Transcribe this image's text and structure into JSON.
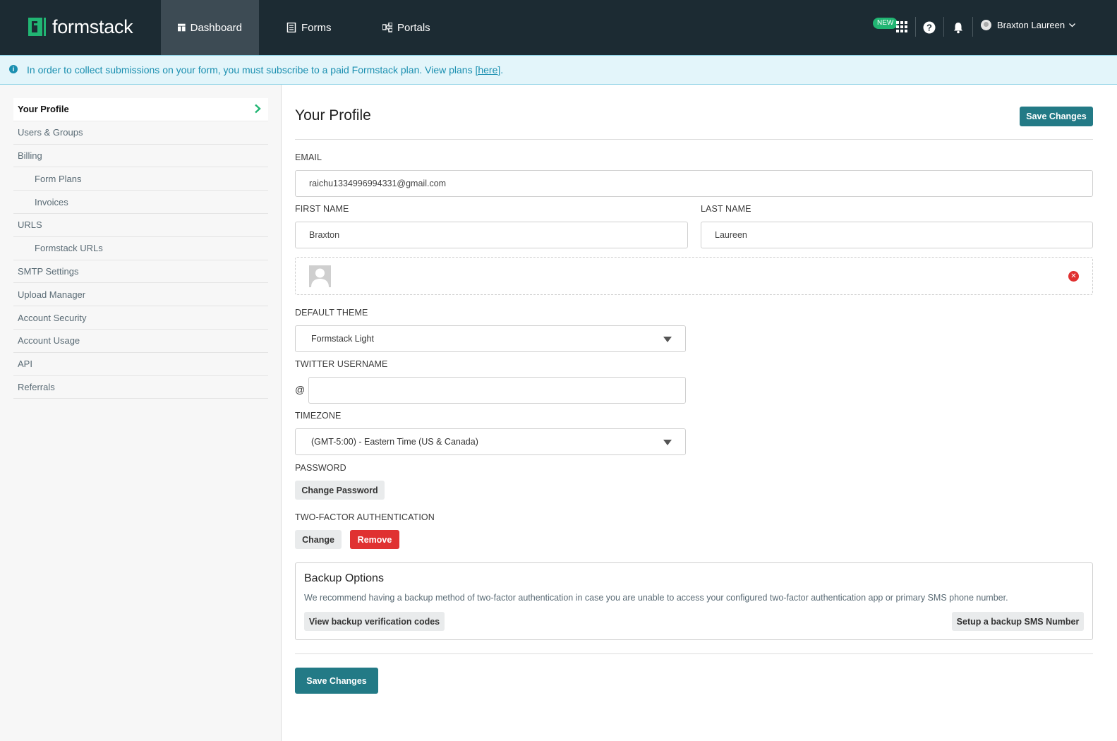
{
  "colors": {
    "topbar": "#1c2b33",
    "brand_green": "#21b573",
    "primary": "#237a86",
    "danger": "#e03131",
    "info": "#1a8fb0"
  },
  "topnav": {
    "logo_text": "formstack",
    "tabs": [
      {
        "label": "Dashboard",
        "icon": "dashboard-icon",
        "active": true
      },
      {
        "label": "Forms",
        "icon": "forms-icon",
        "active": false
      },
      {
        "label": "Portals",
        "icon": "portals-icon",
        "active": false
      }
    ],
    "new_badge": "NEW",
    "user_name": "Braxton Laureen"
  },
  "banner": {
    "text": "In order to collect submissions on your form, you must subscribe to a paid Formstack plan. View plans ",
    "link_text": "[here]",
    "trailing": "."
  },
  "sidebar": {
    "items": [
      {
        "label": "Your Profile",
        "active": true,
        "sub": false
      },
      {
        "label": "Users & Groups",
        "active": false,
        "sub": false
      },
      {
        "label": "Billing",
        "active": false,
        "sub": false
      },
      {
        "label": "Form Plans",
        "active": false,
        "sub": true
      },
      {
        "label": "Invoices",
        "active": false,
        "sub": true
      },
      {
        "label": "URLS",
        "active": false,
        "sub": false
      },
      {
        "label": "Formstack URLs",
        "active": false,
        "sub": true
      },
      {
        "label": "SMTP Settings",
        "active": false,
        "sub": false
      },
      {
        "label": "Upload Manager",
        "active": false,
        "sub": false
      },
      {
        "label": "Account Security",
        "active": false,
        "sub": false
      },
      {
        "label": "Account Usage",
        "active": false,
        "sub": false
      },
      {
        "label": "API",
        "active": false,
        "sub": false
      },
      {
        "label": "Referrals",
        "active": false,
        "sub": false
      }
    ]
  },
  "profile": {
    "title": "Your Profile",
    "save_label": "Save Changes",
    "email_label": "EMAIL",
    "email_value": "raichu1334996994331@gmail.com",
    "first_name_label": "FIRST NAME",
    "first_name_value": "Braxton",
    "last_name_label": "LAST NAME",
    "last_name_value": "Laureen",
    "theme_label": "DEFAULT THEME",
    "theme_value": "Formstack Light",
    "twitter_label": "TWITTER USERNAME",
    "twitter_prefix": "@",
    "twitter_value": "",
    "timezone_label": "TIMEZONE",
    "timezone_value": "(GMT-5:00) - Eastern Time (US & Canada)",
    "password_label": "PASSWORD",
    "change_password_label": "Change Password",
    "twofa_label": "TWO-FACTOR AUTHENTICATION",
    "twofa_change_label": "Change",
    "twofa_remove_label": "Remove",
    "backup": {
      "title": "Backup Options",
      "description": "We recommend having a backup method of two-factor authentication in case you are unable to access your configured two-factor authentication app or primary SMS phone number.",
      "view_codes_label": "View backup verification codes",
      "sms_label": "Setup a backup SMS Number"
    }
  }
}
